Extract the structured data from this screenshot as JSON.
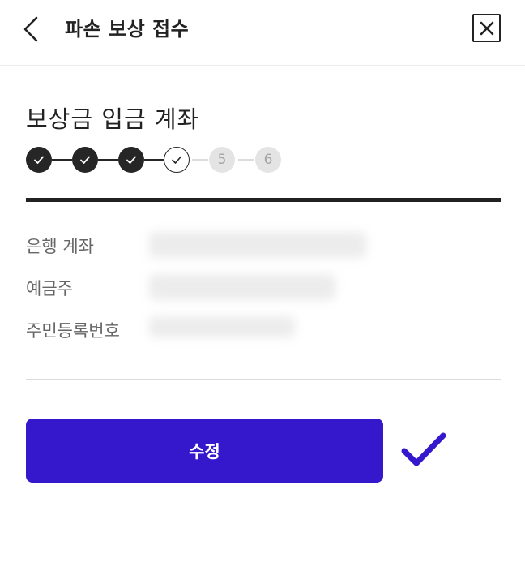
{
  "header": {
    "title": "파손 보상 접수",
    "back_icon": "chevron-left-icon",
    "close_icon": "close-icon"
  },
  "section": {
    "title": "보상금 입금 계좌"
  },
  "stepper": {
    "steps": [
      {
        "state": "done",
        "label": ""
      },
      {
        "state": "done",
        "label": ""
      },
      {
        "state": "done",
        "label": ""
      },
      {
        "state": "current",
        "label": ""
      },
      {
        "state": "pending",
        "label": "5"
      },
      {
        "state": "pending",
        "label": "6"
      }
    ],
    "current_step": 4,
    "total_steps": 6
  },
  "info": {
    "bank_account_label": "은행 계좌",
    "account_holder_label": "예금주",
    "resident_number_label": "주민등록번호"
  },
  "actions": {
    "edit_label": "수정"
  },
  "colors": {
    "accent": "#3618CC",
    "dark": "#262626",
    "pending_circle": "#E4E4E4",
    "pending_text": "#A6A6A6"
  }
}
